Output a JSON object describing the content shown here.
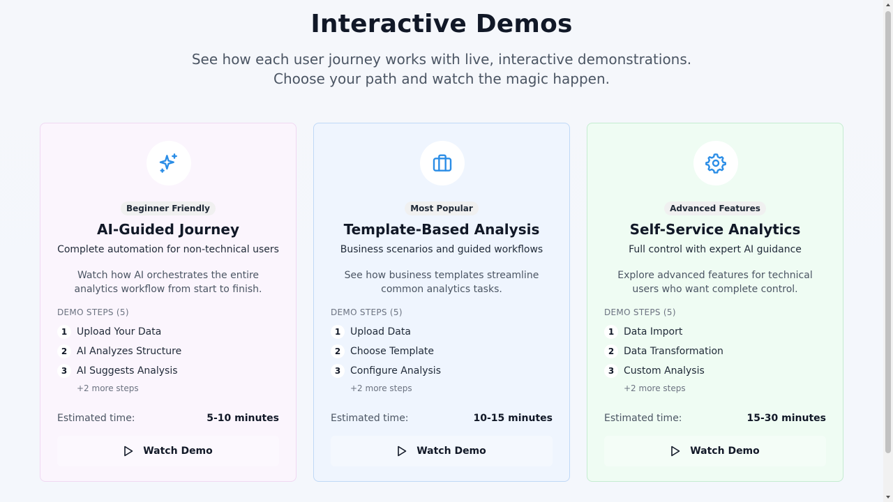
{
  "hero": {
    "title": "Interactive Demos",
    "subtitle": "See how each user journey works with live, interactive demonstrations. Choose your path and watch the magic happen."
  },
  "accent_color": "#2b8de6",
  "cards": [
    {
      "icon": "sparkles-icon",
      "badge": "Beginner Friendly",
      "title": "AI-Guided Journey",
      "tagline": "Complete automation for non-technical users",
      "description": "Watch how AI orchestrates the entire analytics workflow from start to finish.",
      "steps_heading": "DEMO STEPS (5)",
      "steps": [
        {
          "num": "1",
          "label": "Upload Your Data"
        },
        {
          "num": "2",
          "label": "AI Analyzes Structure"
        },
        {
          "num": "3",
          "label": "AI Suggests Analysis"
        }
      ],
      "more_steps": "+2 more steps",
      "time_label": "Estimated time:",
      "time_value": "5-10 minutes",
      "button_label": "Watch Demo",
      "background": "#fbf5fd"
    },
    {
      "icon": "briefcase-icon",
      "badge": "Most Popular",
      "title": "Template-Based Analysis",
      "tagline": "Business scenarios and guided workflows",
      "description": "See how business templates streamline common analytics tasks.",
      "steps_heading": "DEMO STEPS (5)",
      "steps": [
        {
          "num": "1",
          "label": "Upload Data"
        },
        {
          "num": "2",
          "label": "Choose Template"
        },
        {
          "num": "3",
          "label": "Configure Analysis"
        }
      ],
      "more_steps": "+2 more steps",
      "time_label": "Estimated time:",
      "time_value": "10-15 minutes",
      "button_label": "Watch Demo",
      "background": "#eff5fe"
    },
    {
      "icon": "gear-icon",
      "badge": "Advanced Features",
      "title": "Self-Service Analytics",
      "tagline": "Full control with expert AI guidance",
      "description": "Explore advanced features for technical users who want complete control.",
      "steps_heading": "DEMO STEPS (5)",
      "steps": [
        {
          "num": "1",
          "label": "Data Import"
        },
        {
          "num": "2",
          "label": "Data Transformation"
        },
        {
          "num": "3",
          "label": "Custom Analysis"
        }
      ],
      "more_steps": "+2 more steps",
      "time_label": "Estimated time:",
      "time_value": "15-30 minutes",
      "button_label": "Watch Demo",
      "background": "#effcf3"
    }
  ]
}
